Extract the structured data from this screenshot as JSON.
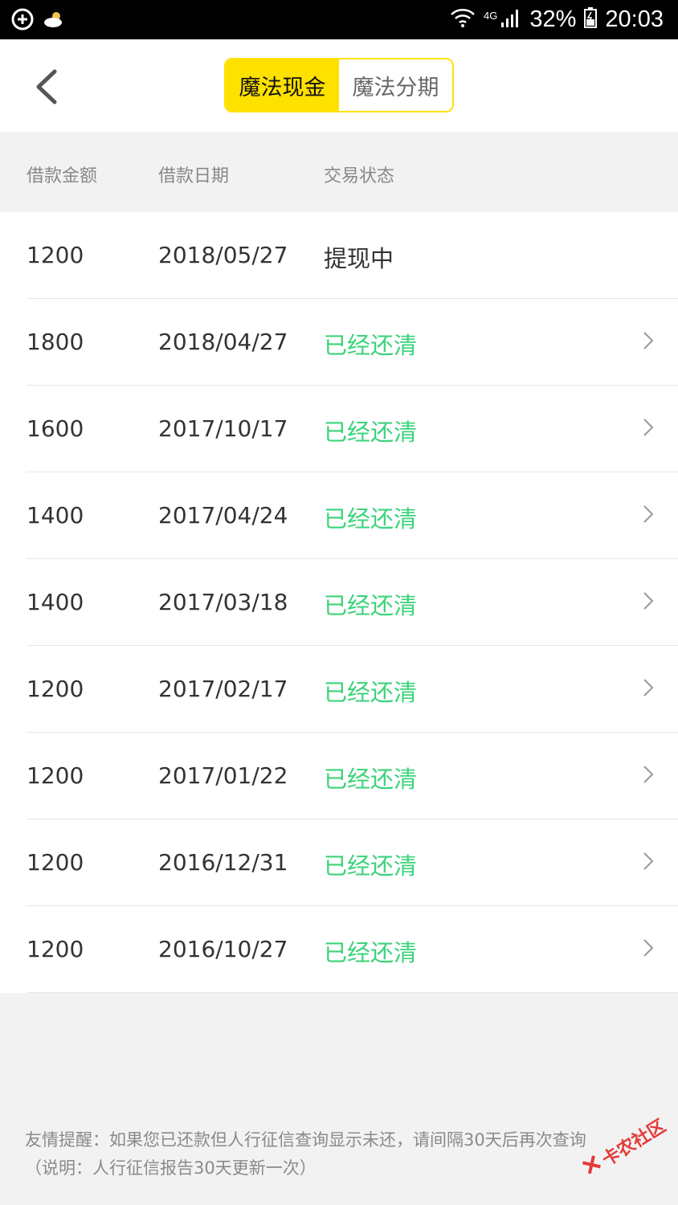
{
  "statusbar": {
    "network": "4G",
    "battery": "32%",
    "time": "20:03"
  },
  "tabs": [
    {
      "label": "魔法现金",
      "active": true
    },
    {
      "label": "魔法分期",
      "active": false
    }
  ],
  "columns": [
    "借款金额",
    "借款日期",
    "交易状态"
  ],
  "rows": [
    {
      "amount": "1200",
      "date": "2018/05/27",
      "status": "提现中",
      "status_color": "#333333",
      "has_chevron": false
    },
    {
      "amount": "1800",
      "date": "2018/04/27",
      "status": "已经还清",
      "status_color": "#3cd37b",
      "has_chevron": true
    },
    {
      "amount": "1600",
      "date": "2017/10/17",
      "status": "已经还清",
      "status_color": "#3cd37b",
      "has_chevron": true
    },
    {
      "amount": "1400",
      "date": "2017/04/24",
      "status": "已经还清",
      "status_color": "#3cd37b",
      "has_chevron": true
    },
    {
      "amount": "1400",
      "date": "2017/03/18",
      "status": "已经还清",
      "status_color": "#3cd37b",
      "has_chevron": true
    },
    {
      "amount": "1200",
      "date": "2017/02/17",
      "status": "已经还清",
      "status_color": "#3cd37b",
      "has_chevron": true
    },
    {
      "amount": "1200",
      "date": "2017/01/22",
      "status": "已经还清",
      "status_color": "#3cd37b",
      "has_chevron": true
    },
    {
      "amount": "1200",
      "date": "2016/12/31",
      "status": "已经还清",
      "status_color": "#3cd37b",
      "has_chevron": true
    },
    {
      "amount": "1200",
      "date": "2016/10/27",
      "status": "已经还清",
      "status_color": "#3cd37b",
      "has_chevron": true
    }
  ],
  "notice": {
    "line1": "友情提醒：如果您已还款但人行征信查询显示未还，请间隔30天后再次查询",
    "line2": "（说明：人行征信报告30天更新一次）"
  },
  "watermark": "卡农社区",
  "colors": {
    "accent": "#ffe100",
    "paid": "#3cd37b"
  }
}
